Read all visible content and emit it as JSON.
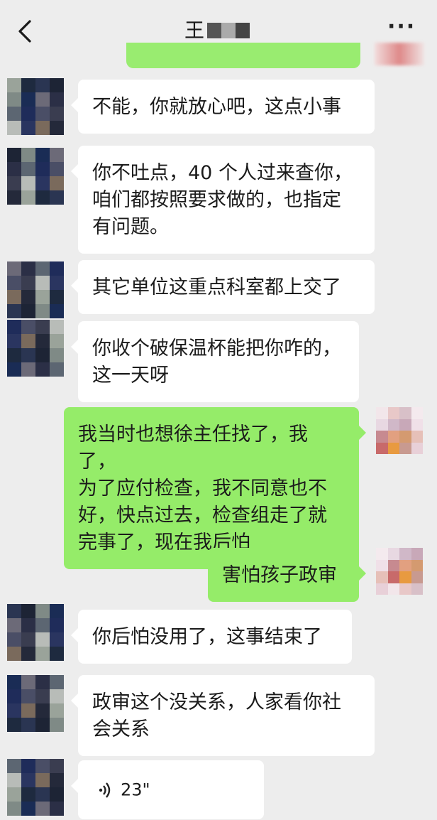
{
  "header": {
    "title": "王",
    "back_icon": "chevron-left-icon",
    "more_label": "···",
    "mask_colors": [
      "#555555",
      "#aaaaaa",
      "#444444"
    ]
  },
  "messages": [
    {
      "side": "left",
      "type": "text",
      "text": "不能，你就放心吧，这点小事"
    },
    {
      "side": "left",
      "type": "text",
      "text": "你不吐点，40 个人过来查你，\n咱们都按照要求做的，也指定\n有问题。"
    },
    {
      "side": "left",
      "type": "text",
      "text": "其它单位这重点科室都上交了"
    },
    {
      "side": "left",
      "type": "text",
      "text": "你收个破保温杯能把你咋的，\n这一天呀"
    },
    {
      "side": "right",
      "type": "text",
      "text": "我当时也想徐主任找了，我了，\n为了应付检查，我不同意也不\n好，快点过去，检查组走了就\n完事了，现在我后怕"
    },
    {
      "side": "right",
      "type": "text",
      "text": "害怕孩子政审"
    },
    {
      "side": "left",
      "type": "text",
      "text": "你后怕没用了，这事结束了"
    },
    {
      "side": "left",
      "type": "text",
      "text": "政审这个没关系，人家看你社\n会关系"
    },
    {
      "side": "left",
      "type": "voice",
      "icon": "voice-wave-icon",
      "duration": "23\""
    }
  ],
  "colors": {
    "background": "#ededed",
    "sent_bubble": "#95ec69",
    "received_bubble": "#ffffff"
  },
  "avatar_left_palette": [
    "#9aa39a",
    "#1e2a3f",
    "#2a3552",
    "#1d2435",
    "#7f8a86",
    "#1a2c55",
    "#6c6a78",
    "#2b2f46",
    "#5c6672",
    "#1f2c5a",
    "#4a4e66",
    "#3a3d50",
    "#b8bcb8",
    "#2a3560",
    "#7a6a5c",
    "#24293a"
  ],
  "avatar_right_palette": [
    "#e8d8e2",
    "#d0b8c8",
    "#c8a8b8",
    "#f0e0e8",
    "#c78a90",
    "#e2a080",
    "#d49a70",
    "#e6c0b8",
    "#c86a6a",
    "#e89a40",
    "#c89a90",
    "#e8d0d8",
    "#f2e6ea",
    "#e8c8c8",
    "#d8c0c8",
    "#f4eaee"
  ]
}
